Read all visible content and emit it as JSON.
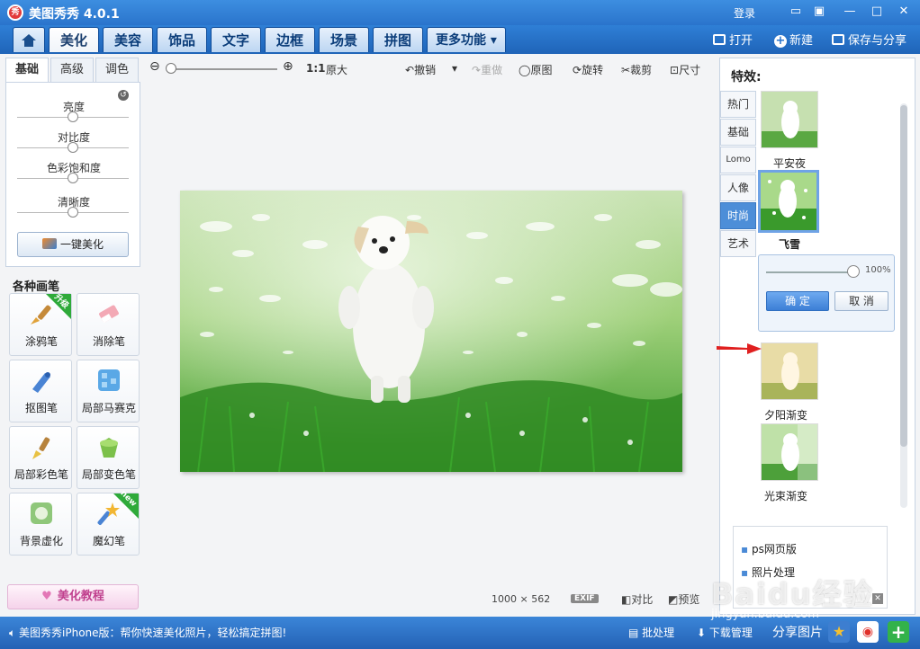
{
  "titlebar": {
    "title": "美图秀秀 4.0.1",
    "logo_text": "秀",
    "login": "登录"
  },
  "menu": {
    "tabs": [
      "美化",
      "美容",
      "饰品",
      "文字",
      "边框",
      "场景",
      "拼图",
      "更多功能"
    ],
    "open": "打开",
    "new": "新建",
    "save_share": "保存与分享"
  },
  "left": {
    "tabs": [
      "基础",
      "高级",
      "调色"
    ],
    "sliders": [
      {
        "label": "亮度",
        "level": 0.5
      },
      {
        "label": "对比度",
        "level": 0.5
      },
      {
        "label": "色彩饱和度",
        "level": 0.5
      },
      {
        "label": "清晰度",
        "level": 0.5
      }
    ],
    "one_key": "一键美化",
    "brushes_title": "各种画笔",
    "brushes": [
      {
        "label": "涂鸦笔",
        "badge": "升级",
        "icon": "paintbrush-icon"
      },
      {
        "label": "消除笔",
        "badge": "",
        "icon": "eraser-icon"
      },
      {
        "label": "抠图笔",
        "badge": "",
        "icon": "cutout-pen-icon"
      },
      {
        "label": "局部马赛克",
        "badge": "",
        "icon": "mosaic-icon"
      },
      {
        "label": "局部彩色笔",
        "badge": "",
        "icon": "color-brush-icon"
      },
      {
        "label": "局部变色笔",
        "badge": "",
        "icon": "paint-bucket-icon"
      },
      {
        "label": "背景虚化",
        "badge": "",
        "icon": "blur-bg-icon"
      },
      {
        "label": "魔幻笔",
        "badge": "new",
        "icon": "magic-wand-icon"
      }
    ],
    "tutorial": "美化教程"
  },
  "toolbar": {
    "ratio": "1:1",
    "original_size": "原大",
    "undo": "撤销",
    "redo": "重做",
    "original": "原图",
    "rotate": "旋转",
    "crop": "裁剪",
    "size": "尺寸"
  },
  "canvas": {
    "dimensions": "1000 × 562",
    "exif": "EXIF",
    "compare": "对比",
    "preview": "预览"
  },
  "effects": {
    "title": "特效:",
    "categories": [
      "热门",
      "基础",
      "Lomo",
      "人像",
      "时尚",
      "艺术"
    ],
    "active_category": "时尚",
    "items": [
      "平安夜",
      "飞雪",
      "夕阳渐变",
      "光束渐变"
    ],
    "popup": {
      "value": "100%",
      "level": 1.0,
      "ok": "确 定",
      "cancel": "取 消"
    },
    "ads": [
      "ps网页版",
      "照片处理"
    ]
  },
  "bottom": {
    "message": "美图秀秀iPhone版：帮你快速美化照片，轻松搞定拼图!",
    "batch": "批处理",
    "download": "下载管理",
    "share": "分享图片"
  },
  "watermark": {
    "main": "Baidu经验",
    "sub": "jingyan.baidu.com"
  }
}
